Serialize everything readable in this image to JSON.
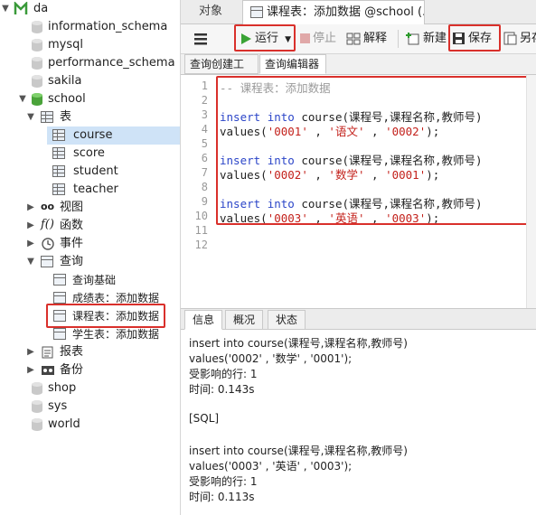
{
  "sidebar": {
    "connection": "da",
    "databases_top": [
      "information_schema",
      "mysql",
      "performance_schema",
      "sakila"
    ],
    "active_db": "school",
    "tables_group": "表",
    "tables": [
      "course",
      "score",
      "student",
      "teacher"
    ],
    "selected_table": "course",
    "views": "视图",
    "functions": "函数",
    "events": "事件",
    "queries_group": "查询",
    "queries": [
      "查询基础",
      "成绩表：添加数据",
      "课程表：添加数据",
      "学生表：添加数据"
    ],
    "highlighted_query": "课程表：添加数据",
    "reports": "报表",
    "backups": "备份",
    "databases_bottom": [
      "shop",
      "sys",
      "world"
    ]
  },
  "tabs": {
    "objects": "对象",
    "document": "课程表：添加数据 @school (..."
  },
  "toolbar": {
    "menu_icon": "hamburger-icon",
    "run": "运行",
    "stop": "停止",
    "explain": "解释",
    "new": "新建",
    "save": "保存",
    "save_as": "另存"
  },
  "subtabs": {
    "builder": "查询创建工具",
    "editor": "查询编辑器"
  },
  "editor": {
    "line_numbers": [
      "1",
      "2",
      "3",
      "4",
      "5",
      "6",
      "7",
      "8",
      "9",
      "10",
      "11",
      "12"
    ],
    "comment": "-- 课程表：添加数据",
    "stmts": [
      {
        "insert": "insert",
        "into": "into",
        "rest": " course(课程号,课程名称,教师号)",
        "values": "values(",
        "v1": "'0001'",
        "sep1": " , ",
        "v2": "'语文'",
        "sep2": " , ",
        "v3": "'0002'",
        "end": ");"
      },
      {
        "insert": "insert",
        "into": "into",
        "rest": " course(课程号,课程名称,教师号)",
        "values": "values(",
        "v1": "'0002'",
        "sep1": " , ",
        "v2": "'数学'",
        "sep2": " , ",
        "v3": "'0001'",
        "end": ");"
      },
      {
        "insert": "insert",
        "into": "into",
        "rest": " course(课程号,课程名称,教师号)",
        "values": "values(",
        "v1": "'0003'",
        "sep1": " , ",
        "v2": "'英语'",
        "sep2": " , ",
        "v3": "'0003'",
        "end": ");"
      }
    ]
  },
  "bottom_tabs": [
    "信息",
    "概况",
    "状态"
  ],
  "info_lines": [
    "insert into course(课程号,课程名称,教师号)",
    "values('0002' , '数学' , '0001');",
    "受影响的行: 1",
    "时间: 0.143s",
    "",
    "[SQL]",
    "",
    "insert into course(课程号,课程名称,教师号)",
    "values('0003' , '英语' , '0003');",
    "受影响的行: 1",
    "时间: 0.113s"
  ],
  "colors": {
    "highlight_red": "#d9302b",
    "keyword_blue": "#2b45c8",
    "string_red": "#c3211b",
    "db_green": "#4aa33a"
  }
}
